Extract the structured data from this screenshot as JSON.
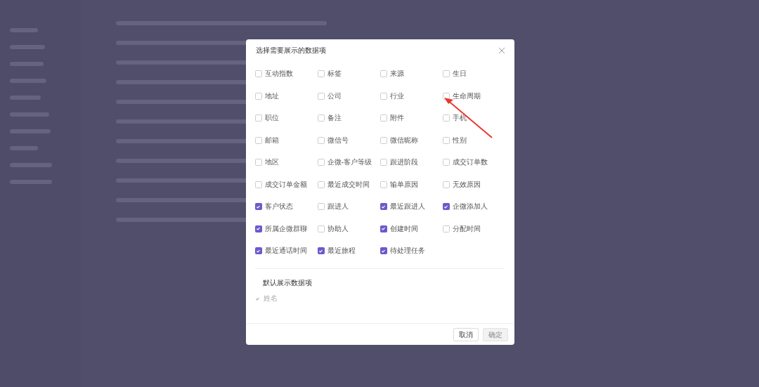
{
  "dialog": {
    "title": "选择需要展示的数据项",
    "options": [
      {
        "label": "互动指数",
        "checked": false
      },
      {
        "label": "标签",
        "checked": false
      },
      {
        "label": "来源",
        "checked": false
      },
      {
        "label": "生日",
        "checked": false
      },
      {
        "label": "地址",
        "checked": false
      },
      {
        "label": "公司",
        "checked": false
      },
      {
        "label": "行业",
        "checked": false
      },
      {
        "label": "生命周期",
        "checked": false
      },
      {
        "label": "职位",
        "checked": false
      },
      {
        "label": "备注",
        "checked": false
      },
      {
        "label": "附件",
        "checked": false
      },
      {
        "label": "手机",
        "checked": false
      },
      {
        "label": "邮箱",
        "checked": false
      },
      {
        "label": "微信号",
        "checked": false
      },
      {
        "label": "微信昵称",
        "checked": false
      },
      {
        "label": "性别",
        "checked": false
      },
      {
        "label": "地区",
        "checked": false
      },
      {
        "label": "企微-客户等级",
        "checked": false
      },
      {
        "label": "跟进阶段",
        "checked": false
      },
      {
        "label": "成交订单数",
        "checked": false
      },
      {
        "label": "成交订单金额",
        "checked": false
      },
      {
        "label": "最近成交时间",
        "checked": false
      },
      {
        "label": "输单原因",
        "checked": false
      },
      {
        "label": "无效原因",
        "checked": false
      },
      {
        "label": "客户状态",
        "checked": true
      },
      {
        "label": "跟进人",
        "checked": false
      },
      {
        "label": "最近跟进人",
        "checked": true
      },
      {
        "label": "企微添加人",
        "checked": true
      },
      {
        "label": "所属企微群聊",
        "checked": true
      },
      {
        "label": "协助人",
        "checked": false
      },
      {
        "label": "创建时间",
        "checked": true
      },
      {
        "label": "分配时间",
        "checked": false
      },
      {
        "label": "最近通话时间",
        "checked": true
      },
      {
        "label": "最近旅程",
        "checked": true
      },
      {
        "label": "待处理任务",
        "checked": true
      }
    ],
    "default_section": {
      "title": "默认展示数据项",
      "items": [
        {
          "label": "姓名",
          "checked": true,
          "disabled": true
        }
      ]
    },
    "buttons": [
      {
        "label": "取消",
        "kind": "secondary",
        "disabled": false
      },
      {
        "label": "确定",
        "kind": "primary",
        "disabled": true
      }
    ]
  }
}
